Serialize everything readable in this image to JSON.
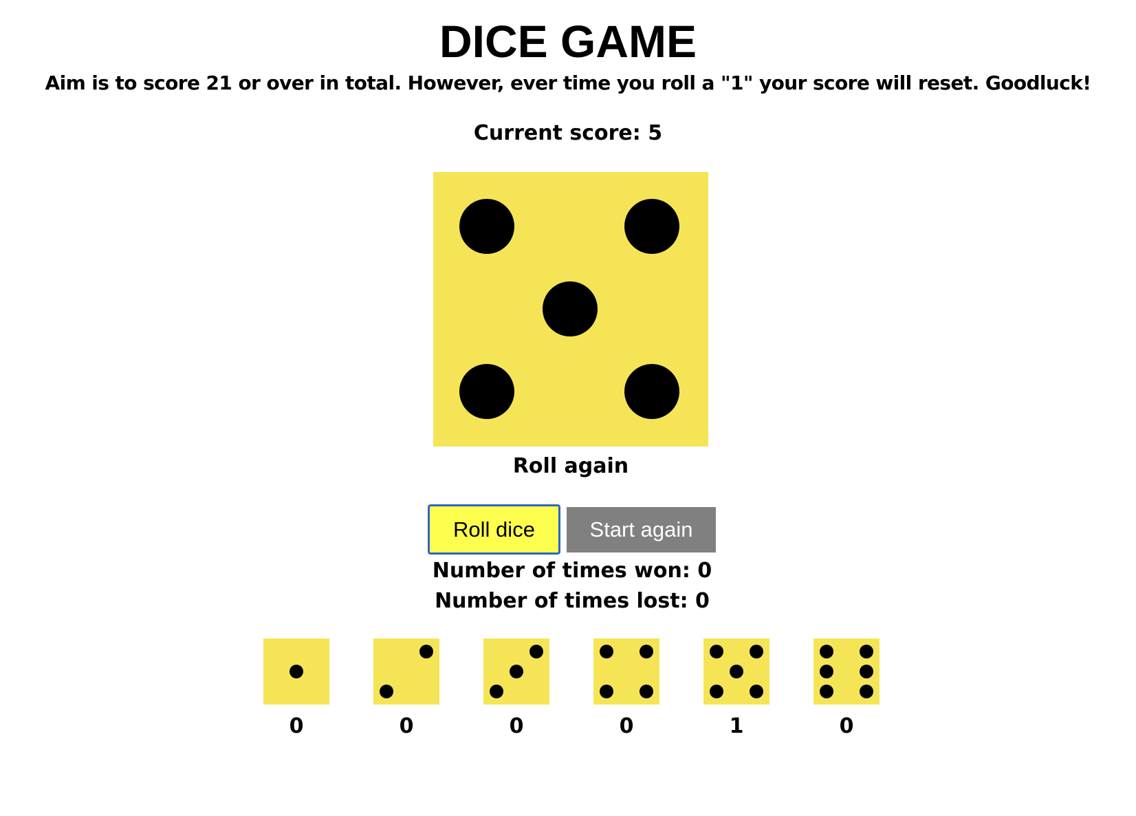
{
  "game": {
    "title": "DICE GAME",
    "instructions": "Aim is to score 21 or over in total. However, ever time you roll a \"1\" your score will reset. Goodluck!",
    "current_score_label": "Current score: 5",
    "current_score": 5,
    "current_die_value": 5,
    "die_color": "#f5e556",
    "pip_color": "#000000",
    "status_message": "Roll again"
  },
  "buttons": {
    "roll_label": "Roll dice",
    "roll_color": "#fefe4f",
    "roll_focus_color": "#2f64c5",
    "start_again_label": "Start again",
    "start_again_color": "#808080"
  },
  "stats": {
    "won_label": "Number of times won: 0",
    "won": 0,
    "lost_label": "Number of times lost: 0",
    "lost": 0
  },
  "history": [
    {
      "face": 1,
      "count": "0"
    },
    {
      "face": 2,
      "count": "0"
    },
    {
      "face": 3,
      "count": "0"
    },
    {
      "face": 4,
      "count": "0"
    },
    {
      "face": 5,
      "count": "1"
    },
    {
      "face": 6,
      "count": "0"
    }
  ]
}
